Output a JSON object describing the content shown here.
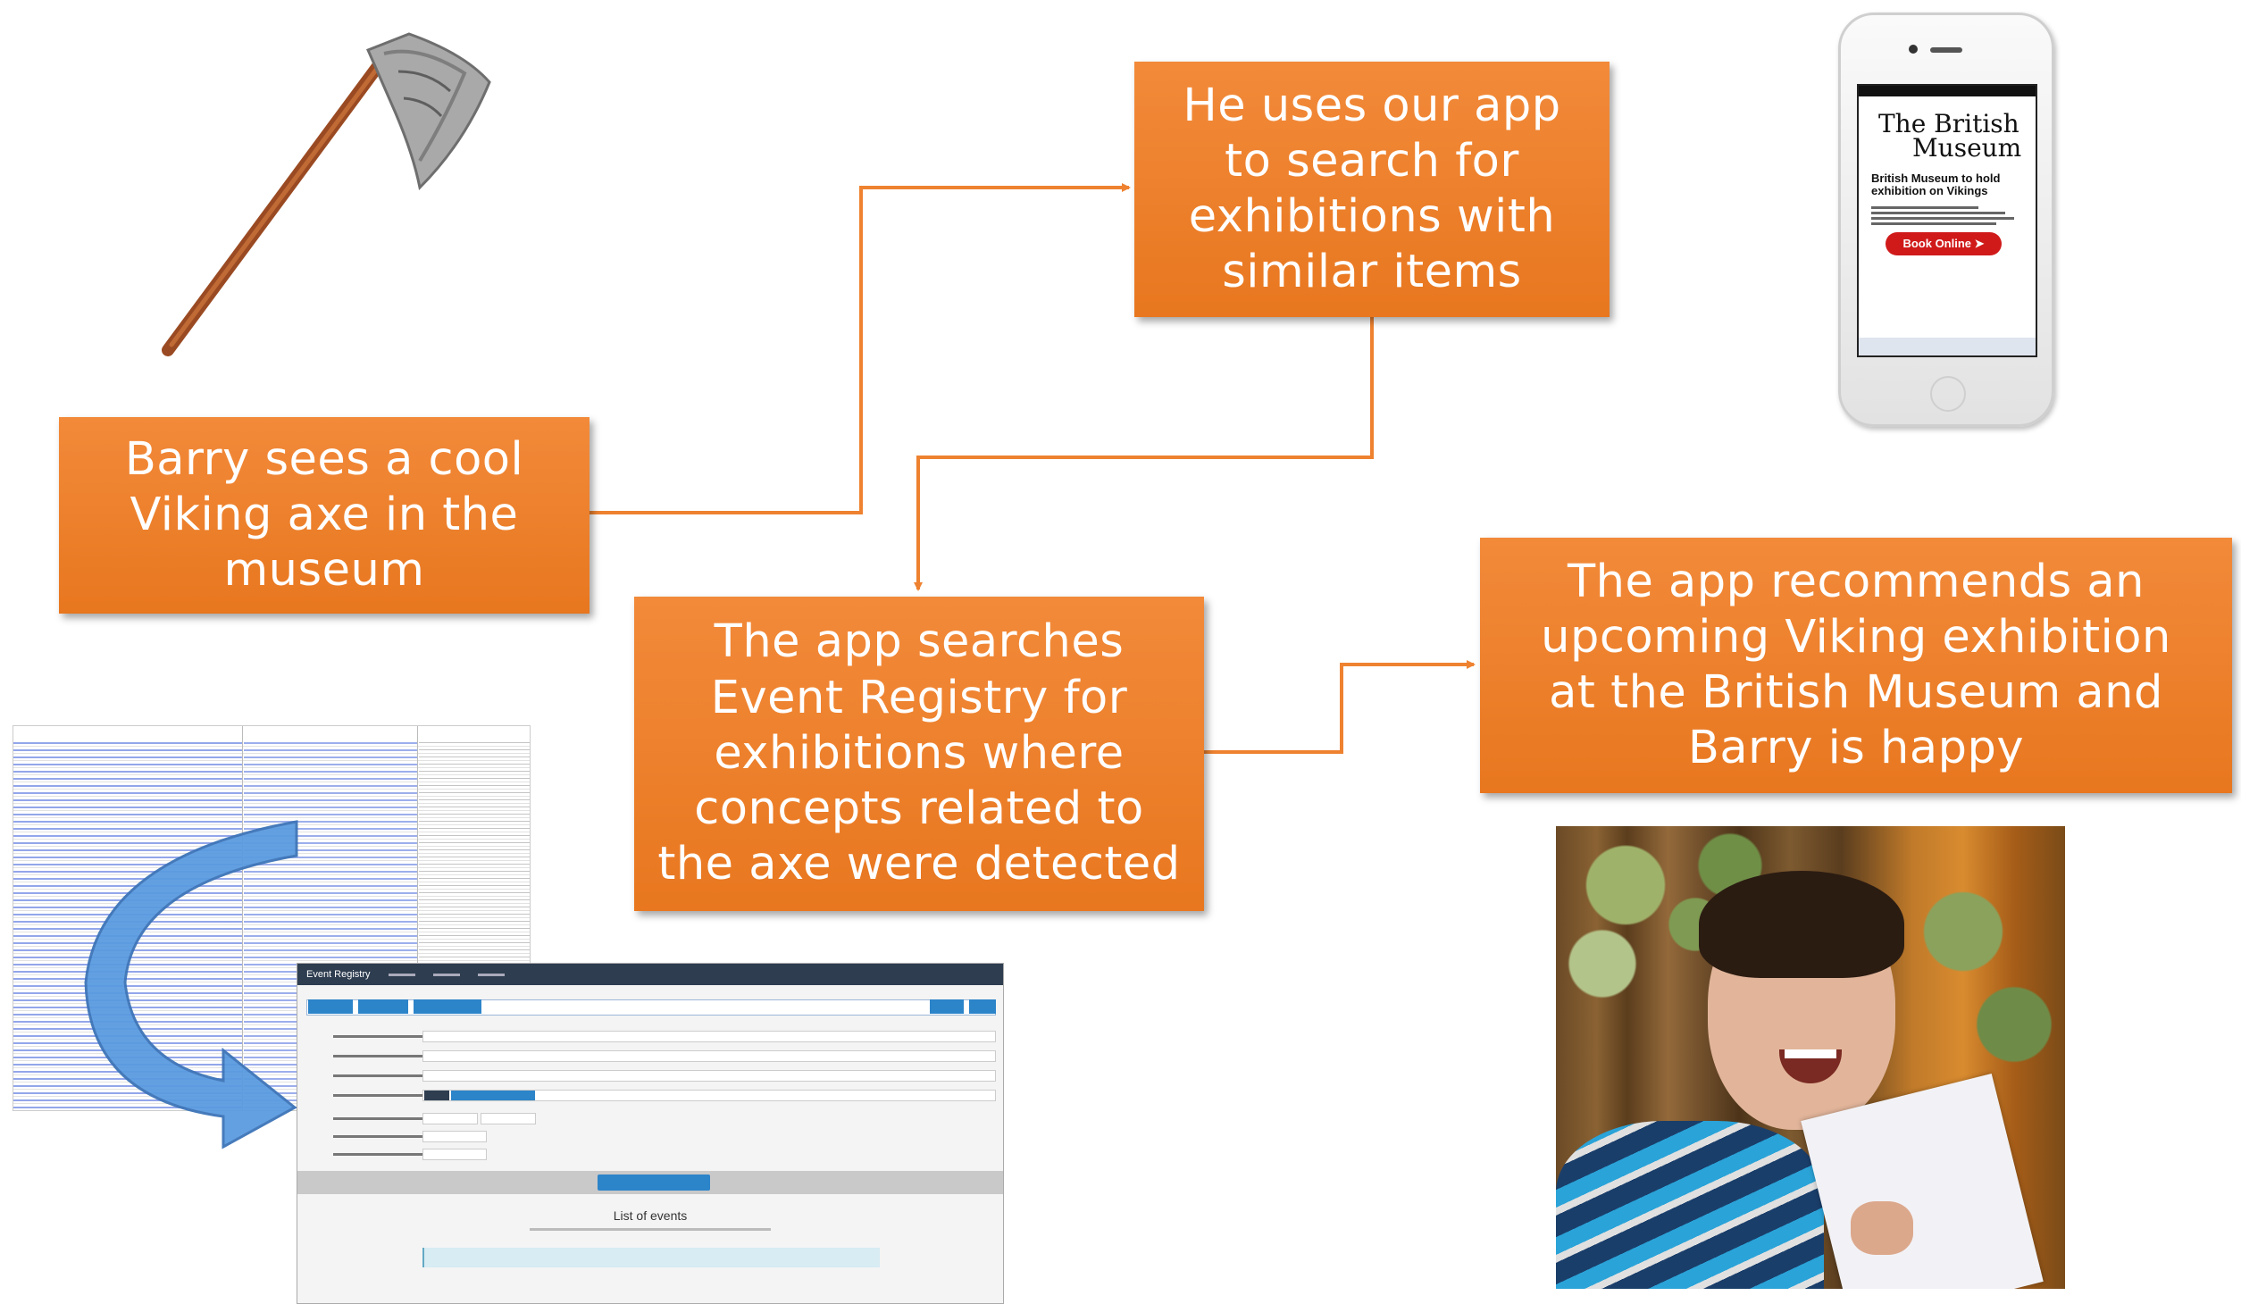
{
  "boxes": {
    "barry": "Barry sees a cool\nViking axe in the\nmuseum",
    "search": "He uses our app\nto search for\nexhibitions with\nsimilar items",
    "registry": "The app searches\nEvent Registry for\nexhibitions where\nconcepts related to\nthe axe were detected",
    "recommend": "The app recommends an\nupcoming Viking exhibition\nat the British Museum and\nBarry is happy"
  },
  "phone": {
    "brand_line1": "The British",
    "brand_line2": "Museum",
    "headline": "British Museum to hold exhibition on Vikings",
    "button": "Book Online"
  },
  "event_registry": {
    "app_name": "Event Registry",
    "list_title": "List of events"
  },
  "colors": {
    "box_orange": "#ee8230",
    "connector": "#ee8230",
    "curved_arrow": "#4f8fd6"
  }
}
